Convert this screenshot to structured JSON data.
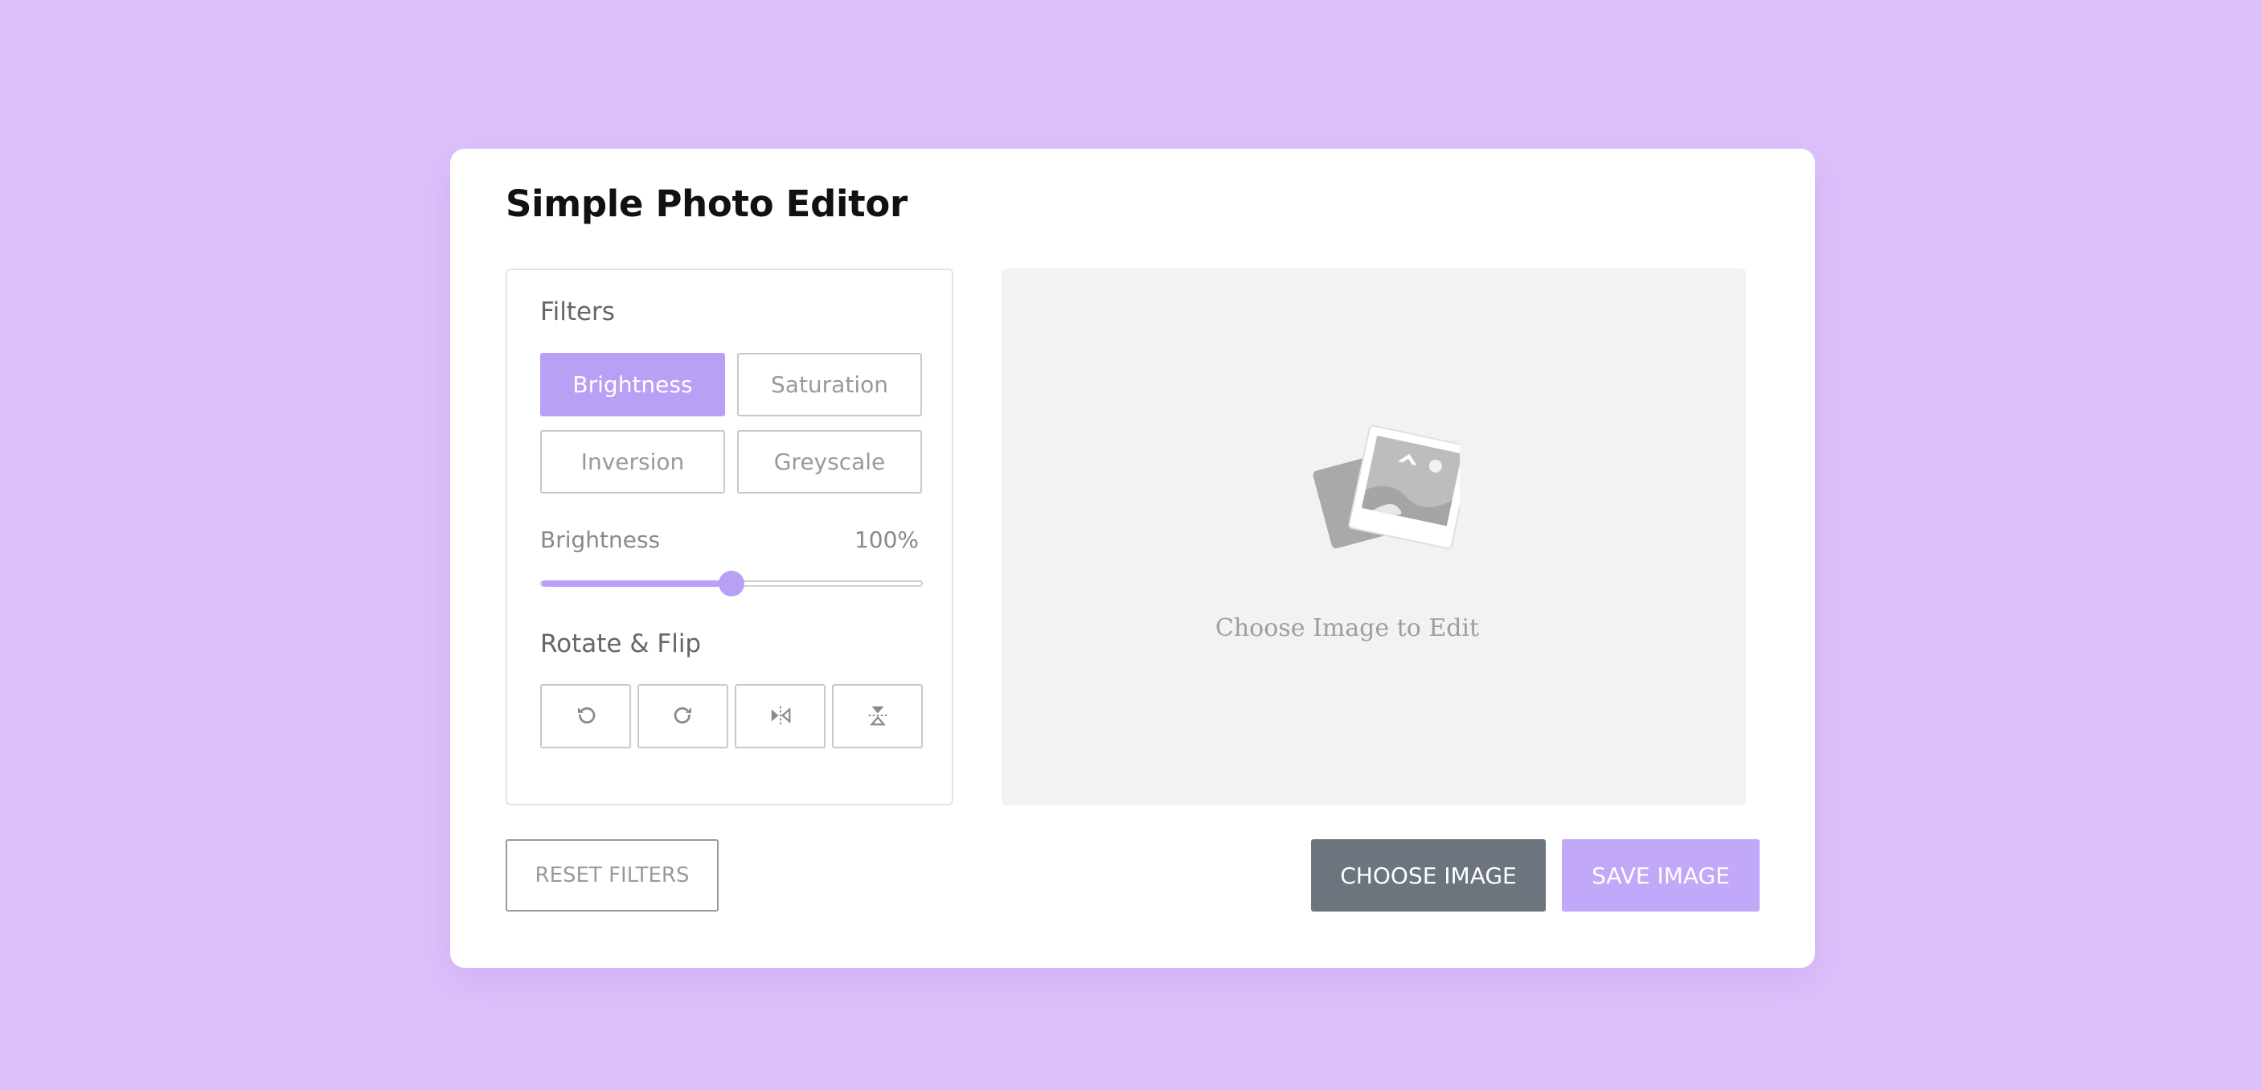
{
  "app": {
    "title": "Simple Photo Editor"
  },
  "filters": {
    "title": "Filters",
    "options": [
      {
        "label": "Brightness",
        "active": true
      },
      {
        "label": "Saturation",
        "active": false
      },
      {
        "label": "Inversion",
        "active": false
      },
      {
        "label": "Greyscale",
        "active": false
      }
    ]
  },
  "slider": {
    "label": "Brightness",
    "value_text": "100%",
    "value": 100,
    "max": 200
  },
  "rotate": {
    "title": "Rotate & Flip",
    "icons": [
      "rotate-left-icon",
      "rotate-right-icon",
      "flip-horizontal-icon",
      "flip-vertical-icon"
    ]
  },
  "preview": {
    "placeholder_text": "Choose Image to Edit",
    "icon": "image-placeholder-icon"
  },
  "actions": {
    "reset_label": "RESET FILTERS",
    "choose_label": "CHOOSE IMAGE",
    "save_label": "SAVE IMAGE"
  },
  "colors": {
    "background": "#dcc0fa",
    "accent": "#b8a0f5",
    "choose_button": "#6c757d",
    "save_button": "#c2a8f8"
  }
}
